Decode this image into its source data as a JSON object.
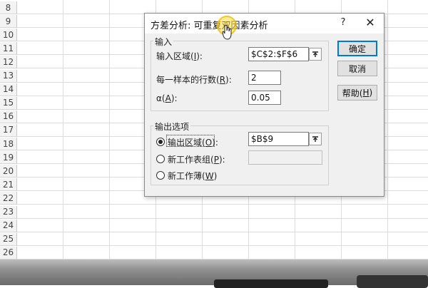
{
  "sheet": {
    "row_numbers": [
      "8",
      "9",
      "10",
      "11",
      "12",
      "13",
      "14",
      "15",
      "16",
      "17",
      "18",
      "19",
      "20",
      "21",
      "22",
      "23",
      "24",
      "25",
      "26"
    ]
  },
  "dialog": {
    "title": "方差分析: 可重复双因素分析",
    "help_glyph": "?",
    "close_glyph": "✕",
    "input_group": {
      "label": "输入",
      "range_label_prefix": "输入区域(",
      "range_label_key": "I",
      "range_label_suffix": "):",
      "range_value": "$C$2:$F$6",
      "rows_label_prefix": "每一样本的行数(",
      "rows_label_key": "R",
      "rows_label_suffix": "):",
      "rows_value": "2",
      "alpha_label_prefix": "α(",
      "alpha_label_key": "A",
      "alpha_label_suffix": "):",
      "alpha_value": "0.05"
    },
    "output_group": {
      "label": "输出选项",
      "output_range_prefix": "输出区域(",
      "output_range_key": "O",
      "output_range_suffix": "):",
      "output_range_value": "$B$9",
      "new_sheet_prefix": "新工作表组(",
      "new_sheet_key": "P",
      "new_sheet_suffix": "):",
      "new_sheet_value": "",
      "new_workbook_prefix": "新工作薄(",
      "new_workbook_key": "W",
      "new_workbook_suffix": ")",
      "selected_option": "output_range"
    },
    "buttons": {
      "ok": "确定",
      "cancel": "取消",
      "help_prefix": "帮助(",
      "help_key": "H",
      "help_suffix": ")"
    }
  },
  "icons": {
    "collapse": "collapse-dialog-icon",
    "cursor": "mouse-pointer-icon"
  },
  "colors": {
    "dialog_bg": "#f0f0f0",
    "default_button_border": "#0078d7",
    "cursor_highlight": "#ffdc3c"
  }
}
